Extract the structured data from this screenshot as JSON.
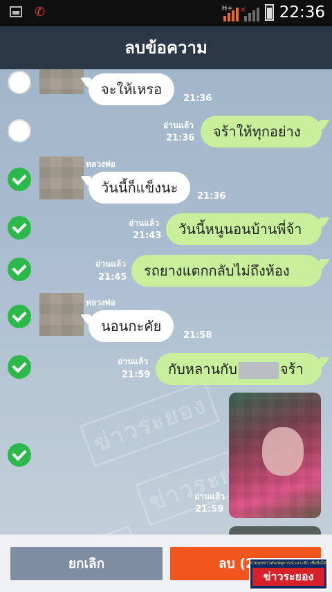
{
  "statusbar": {
    "time": "22:36",
    "network": "H+",
    "no_signal": "×",
    "icons": [
      "image-notification-icon",
      "missed-call-icon",
      "signal-icon",
      "battery-icon"
    ]
  },
  "header": {
    "title": "ลบข้อความ"
  },
  "messages": [
    {
      "direction": "in",
      "text": "จะให้เหรอ",
      "time": "21:36",
      "selected": false
    },
    {
      "direction": "out",
      "text": "จร้าให้ทุกอย่าง",
      "read": "อ่านแล้ว",
      "time": "21:36",
      "selected": false
    },
    {
      "direction": "in",
      "sender": "หลวงพ่อ",
      "text": "วันนี้ก็แข็งนะ",
      "time": "21:36",
      "selected": true
    },
    {
      "direction": "out",
      "text": "วันนี้หนูนอนบ้านพี่จ้า",
      "read": "อ่านแล้ว",
      "time": "21:43",
      "selected": true
    },
    {
      "direction": "out",
      "text": "รถยางแตกกลับไม่ถึงห้อง",
      "read": "อ่านแล้ว",
      "time": "21:45",
      "selected": true
    },
    {
      "direction": "in",
      "sender": "หลวงพ่อ",
      "text": "นอนกะคัย",
      "time": "21:58",
      "selected": true
    },
    {
      "direction": "out",
      "text_before": "กับหลานกับ",
      "text_after": "จร้า",
      "read": "อ่านแล้ว",
      "time": "21:59",
      "selected": true
    },
    {
      "direction": "out",
      "type": "photo",
      "read": "อ่านแล้ว",
      "time": "21:59",
      "selected": true
    }
  ],
  "watermark": {
    "text": "ข่าวระยอง"
  },
  "buttons": {
    "cancel": "ยกเลิก",
    "delete": "ลบ (2"
  },
  "logo": {
    "main": "ข่าวระยอง",
    "tagline": "รวมทุกข่าวทันเหตุการณ์ เจาะลึก เชื่อถือได้"
  },
  "colors": {
    "header": "#2c3848",
    "out_bubble": "#c7ef9c",
    "in_bubble": "#ffffff",
    "check": "#2bb94a",
    "delete": "#f2561f",
    "cancel": "#7e8da1"
  }
}
